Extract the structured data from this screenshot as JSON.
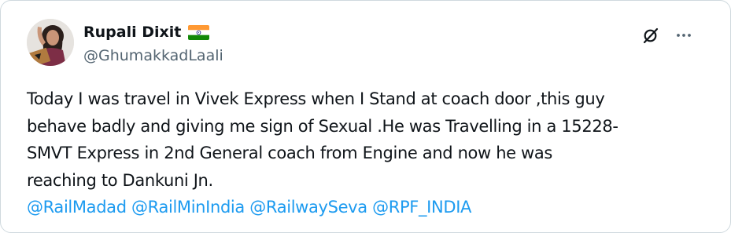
{
  "author": {
    "name": "Rupali Dixit",
    "handle": "@GhumakkadLaali",
    "flag_icon": "india-flag-icon"
  },
  "actions": {
    "grok_icon": "grok-icon",
    "more_icon": "more-dots-icon"
  },
  "tweet": {
    "lines": [
      "Today I was travel in Vivek Express when I Stand at coach door ,this guy",
      "behave badly and giving me sign of Sexual .He was Travelling in a 15228-",
      "SMVT Express in 2nd General coach from Engine and now he was",
      "reaching to Dankuni Jn."
    ],
    "mentions": [
      "@RailMadad",
      "@RailMinIndia",
      "@RailwaySeva",
      "@RPF_INDIA"
    ]
  },
  "colors": {
    "text": "#0f1419",
    "secondary": "#536471",
    "link": "#1d9bf0",
    "border": "#cfd9de"
  }
}
